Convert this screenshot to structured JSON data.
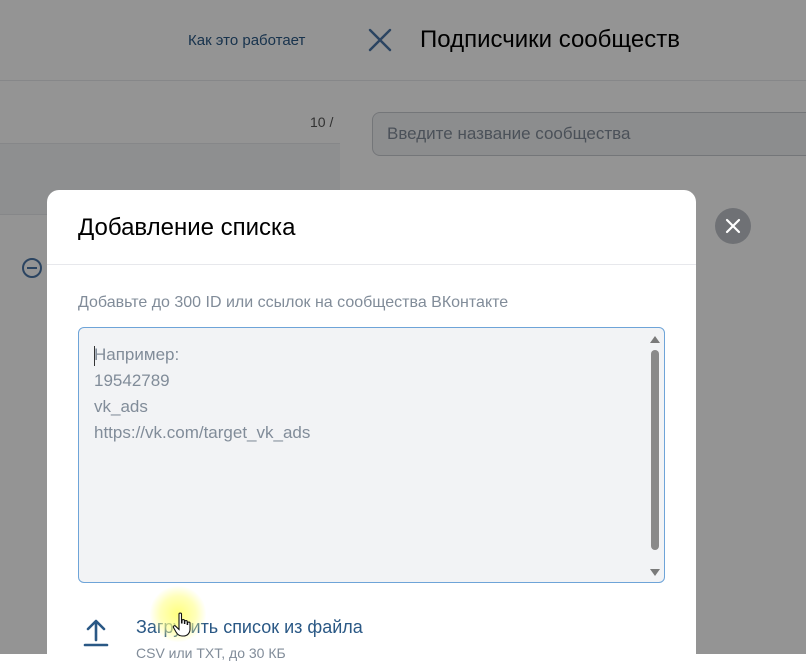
{
  "background": {
    "how_it_works_link": "Как это работает",
    "count_text": "10 /"
  },
  "side_panel": {
    "title": "Подписчики сообществ",
    "close_icon": "close-icon",
    "search_placeholder": "Введите название сообщества"
  },
  "modal": {
    "title": "Добавление списка",
    "hint": "Добавьте до 300 ID или ссылок на сообщества ВКонтакте",
    "textarea_placeholder": "Например:\n19542789\nvk_ads\nhttps://vk.com/target_vk_ads",
    "upload_link": "Загрузить список из файла",
    "upload_note": "CSV или TXT, до 30 КБ",
    "close_icon": "close-icon",
    "upload_icon": "upload-arrow-icon"
  },
  "colors": {
    "link": "#2a5885",
    "hint": "#818c99",
    "focus_border": "#6ea4d8",
    "overlay": "rgba(0,0,0,0.42)"
  }
}
